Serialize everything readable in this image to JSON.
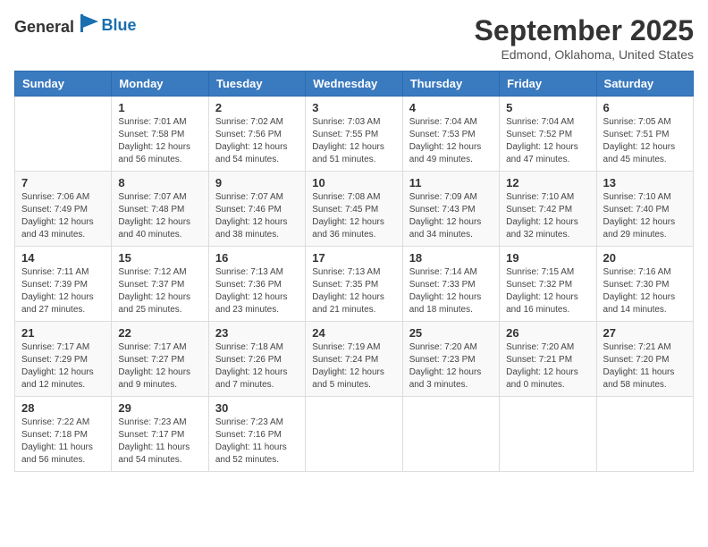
{
  "header": {
    "logo_general": "General",
    "logo_blue": "Blue",
    "month": "September 2025",
    "location": "Edmond, Oklahoma, United States"
  },
  "weekdays": [
    "Sunday",
    "Monday",
    "Tuesday",
    "Wednesday",
    "Thursday",
    "Friday",
    "Saturday"
  ],
  "weeks": [
    [
      {
        "day": "",
        "info": ""
      },
      {
        "day": "1",
        "info": "Sunrise: 7:01 AM\nSunset: 7:58 PM\nDaylight: 12 hours\nand 56 minutes."
      },
      {
        "day": "2",
        "info": "Sunrise: 7:02 AM\nSunset: 7:56 PM\nDaylight: 12 hours\nand 54 minutes."
      },
      {
        "day": "3",
        "info": "Sunrise: 7:03 AM\nSunset: 7:55 PM\nDaylight: 12 hours\nand 51 minutes."
      },
      {
        "day": "4",
        "info": "Sunrise: 7:04 AM\nSunset: 7:53 PM\nDaylight: 12 hours\nand 49 minutes."
      },
      {
        "day": "5",
        "info": "Sunrise: 7:04 AM\nSunset: 7:52 PM\nDaylight: 12 hours\nand 47 minutes."
      },
      {
        "day": "6",
        "info": "Sunrise: 7:05 AM\nSunset: 7:51 PM\nDaylight: 12 hours\nand 45 minutes."
      }
    ],
    [
      {
        "day": "7",
        "info": "Sunrise: 7:06 AM\nSunset: 7:49 PM\nDaylight: 12 hours\nand 43 minutes."
      },
      {
        "day": "8",
        "info": "Sunrise: 7:07 AM\nSunset: 7:48 PM\nDaylight: 12 hours\nand 40 minutes."
      },
      {
        "day": "9",
        "info": "Sunrise: 7:07 AM\nSunset: 7:46 PM\nDaylight: 12 hours\nand 38 minutes."
      },
      {
        "day": "10",
        "info": "Sunrise: 7:08 AM\nSunset: 7:45 PM\nDaylight: 12 hours\nand 36 minutes."
      },
      {
        "day": "11",
        "info": "Sunrise: 7:09 AM\nSunset: 7:43 PM\nDaylight: 12 hours\nand 34 minutes."
      },
      {
        "day": "12",
        "info": "Sunrise: 7:10 AM\nSunset: 7:42 PM\nDaylight: 12 hours\nand 32 minutes."
      },
      {
        "day": "13",
        "info": "Sunrise: 7:10 AM\nSunset: 7:40 PM\nDaylight: 12 hours\nand 29 minutes."
      }
    ],
    [
      {
        "day": "14",
        "info": "Sunrise: 7:11 AM\nSunset: 7:39 PM\nDaylight: 12 hours\nand 27 minutes."
      },
      {
        "day": "15",
        "info": "Sunrise: 7:12 AM\nSunset: 7:37 PM\nDaylight: 12 hours\nand 25 minutes."
      },
      {
        "day": "16",
        "info": "Sunrise: 7:13 AM\nSunset: 7:36 PM\nDaylight: 12 hours\nand 23 minutes."
      },
      {
        "day": "17",
        "info": "Sunrise: 7:13 AM\nSunset: 7:35 PM\nDaylight: 12 hours\nand 21 minutes."
      },
      {
        "day": "18",
        "info": "Sunrise: 7:14 AM\nSunset: 7:33 PM\nDaylight: 12 hours\nand 18 minutes."
      },
      {
        "day": "19",
        "info": "Sunrise: 7:15 AM\nSunset: 7:32 PM\nDaylight: 12 hours\nand 16 minutes."
      },
      {
        "day": "20",
        "info": "Sunrise: 7:16 AM\nSunset: 7:30 PM\nDaylight: 12 hours\nand 14 minutes."
      }
    ],
    [
      {
        "day": "21",
        "info": "Sunrise: 7:17 AM\nSunset: 7:29 PM\nDaylight: 12 hours\nand 12 minutes."
      },
      {
        "day": "22",
        "info": "Sunrise: 7:17 AM\nSunset: 7:27 PM\nDaylight: 12 hours\nand 9 minutes."
      },
      {
        "day": "23",
        "info": "Sunrise: 7:18 AM\nSunset: 7:26 PM\nDaylight: 12 hours\nand 7 minutes."
      },
      {
        "day": "24",
        "info": "Sunrise: 7:19 AM\nSunset: 7:24 PM\nDaylight: 12 hours\nand 5 minutes."
      },
      {
        "day": "25",
        "info": "Sunrise: 7:20 AM\nSunset: 7:23 PM\nDaylight: 12 hours\nand 3 minutes."
      },
      {
        "day": "26",
        "info": "Sunrise: 7:20 AM\nSunset: 7:21 PM\nDaylight: 12 hours\nand 0 minutes."
      },
      {
        "day": "27",
        "info": "Sunrise: 7:21 AM\nSunset: 7:20 PM\nDaylight: 11 hours\nand 58 minutes."
      }
    ],
    [
      {
        "day": "28",
        "info": "Sunrise: 7:22 AM\nSunset: 7:18 PM\nDaylight: 11 hours\nand 56 minutes."
      },
      {
        "day": "29",
        "info": "Sunrise: 7:23 AM\nSunset: 7:17 PM\nDaylight: 11 hours\nand 54 minutes."
      },
      {
        "day": "30",
        "info": "Sunrise: 7:23 AM\nSunset: 7:16 PM\nDaylight: 11 hours\nand 52 minutes."
      },
      {
        "day": "",
        "info": ""
      },
      {
        "day": "",
        "info": ""
      },
      {
        "day": "",
        "info": ""
      },
      {
        "day": "",
        "info": ""
      }
    ]
  ]
}
